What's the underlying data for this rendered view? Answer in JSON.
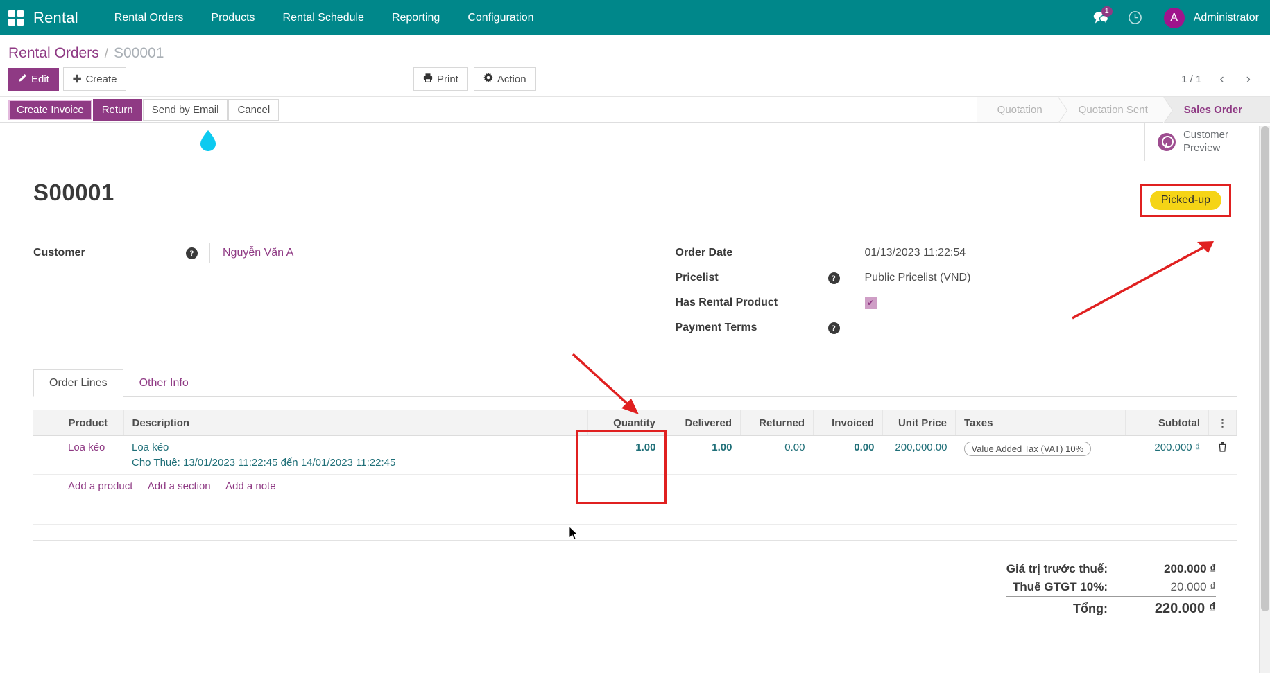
{
  "navbar": {
    "apps_icon": "apps-grid-icon",
    "brand": "Rental",
    "menu": [
      {
        "label": "Rental Orders"
      },
      {
        "label": "Products"
      },
      {
        "label": "Rental Schedule"
      },
      {
        "label": "Reporting"
      },
      {
        "label": "Configuration"
      }
    ],
    "messages_icon": "messages-icon",
    "messages_count": "1",
    "activities_icon": "clock-icon",
    "avatar_initial": "A",
    "user_name": "Administrator",
    "bg_color": "#00878a",
    "accent_color": "#8f3a84"
  },
  "breadcrumb": {
    "root": "Rental Orders",
    "separator": "/",
    "current": "S00001"
  },
  "control_panel": {
    "edit_label": "Edit",
    "edit_icon": "pencil-icon",
    "create_label": "Create",
    "create_icon": "plus-icon",
    "print_label": "Print",
    "print_icon": "printer-icon",
    "action_label": "Action",
    "action_icon": "gear-icon",
    "pager": "1 / 1",
    "prev_icon": "chevron-left-icon",
    "next_icon": "chevron-right-icon"
  },
  "statusbar": {
    "buttons": [
      {
        "label": "Create Invoice",
        "style": "highlighted-primary"
      },
      {
        "label": "Return",
        "style": "primary"
      },
      {
        "label": "Send by Email",
        "style": "default"
      },
      {
        "label": "Cancel",
        "style": "default"
      }
    ],
    "stages": [
      {
        "label": "Quotation",
        "active": false
      },
      {
        "label": "Quotation Sent",
        "active": false
      },
      {
        "label": "Sales Order",
        "active": true
      }
    ]
  },
  "stat_button": {
    "icon": "globe-icon",
    "line1": "Customer",
    "line2": "Preview"
  },
  "record": {
    "title": "S00001",
    "status_badge": "Picked-up",
    "status_badge_color": "#f5d416"
  },
  "form": {
    "left": [
      {
        "label": "Customer",
        "help_icon": "question-mark-icon",
        "value": "Nguyễn Văn A",
        "type": "link",
        "name": "customer-field"
      }
    ],
    "right": [
      {
        "label": "Order Date",
        "help_icon": null,
        "value": "01/13/2023 11:22:54",
        "type": "text",
        "name": "order-date-field"
      },
      {
        "label": "Pricelist",
        "help_icon": "question-mark-icon",
        "value": "Public Pricelist (VND)",
        "type": "text",
        "name": "pricelist-field"
      },
      {
        "label": "Has Rental Product",
        "help_icon": null,
        "value": "✔",
        "type": "checkbox",
        "name": "has-rental-product-checkbox"
      },
      {
        "label": "Payment Terms",
        "help_icon": "question-mark-icon",
        "value": "",
        "type": "text",
        "name": "payment-terms-field"
      }
    ]
  },
  "notebook": {
    "tabs": [
      {
        "label": "Order Lines",
        "active": true
      },
      {
        "label": "Other Info",
        "active": false
      }
    ]
  },
  "order_lines": {
    "columns": [
      {
        "label": "",
        "align": "left"
      },
      {
        "label": "Product",
        "align": "left"
      },
      {
        "label": "Description",
        "align": "left"
      },
      {
        "label": "Quantity",
        "align": "right"
      },
      {
        "label": "Delivered",
        "align": "right"
      },
      {
        "label": "Returned",
        "align": "right"
      },
      {
        "label": "Invoiced",
        "align": "right"
      },
      {
        "label": "Unit Price",
        "align": "right"
      },
      {
        "label": "Taxes",
        "align": "left"
      },
      {
        "label": "Subtotal",
        "align": "right"
      },
      {
        "label": "⋮",
        "align": "center"
      }
    ],
    "rows": [
      {
        "product": "Loa kéo",
        "description_main": "Loa kéo",
        "description_sub": "Cho Thuê: 13/01/2023 11:22:45 đến 14/01/2023 11:22:45",
        "quantity": "1.00",
        "delivered": "1.00",
        "returned": "0.00",
        "invoiced": "0.00",
        "unit_price": "200,000.00",
        "taxes": "Value Added Tax (VAT) 10%",
        "subtotal": "200.000 ₫",
        "delete_icon": "trash-icon"
      }
    ],
    "add_links": [
      {
        "label": "Add a product"
      },
      {
        "label": "Add a section"
      },
      {
        "label": "Add a note"
      }
    ]
  },
  "totals": {
    "subtotal_label": "Giá trị trước thuế:",
    "subtotal_value": "200.000 ₫",
    "tax_label": "Thuế GTGT 10%:",
    "tax_value": "20.000 ₫",
    "total_label": "Tổng:",
    "total_value": "220.000 ₫"
  },
  "annotations": {
    "arrow_to_badge": "red-arrow-pointing-to-picked-up-badge",
    "arrow_to_delivered": "red-arrow-pointing-to-delivered-column",
    "box_badge": "red-box-around-picked-up-badge",
    "box_delivered": "red-box-around-delivered-column",
    "color": "#e02020"
  }
}
